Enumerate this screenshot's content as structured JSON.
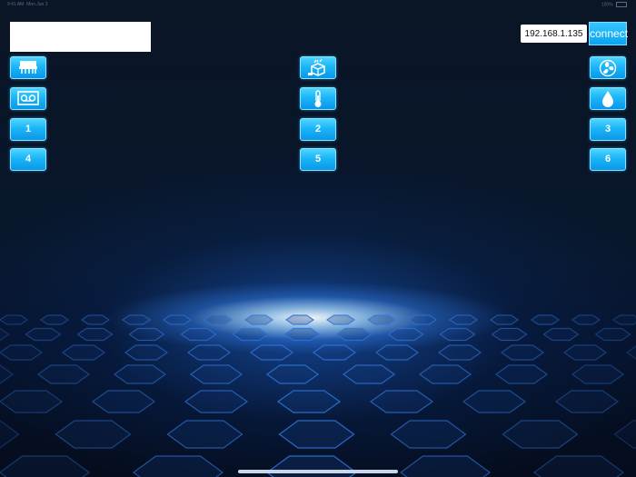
{
  "status_bar": {
    "time": "9:41 AM",
    "date": "Mon Jun 3",
    "battery": "100%"
  },
  "connection": {
    "ip_value": "192.168.1.135",
    "connect_label": "connect"
  },
  "device_name": {
    "value": ""
  },
  "buttons": {
    "b1": "1",
    "b2": "2",
    "b3": "3",
    "b4": "4",
    "b5": "5",
    "b6": "6"
  },
  "icons": {
    "left_row1": "printer-icon",
    "left_row2": "cassette-icon",
    "mid_row1": "package-box-icon",
    "mid_row2": "thermometer-icon",
    "right_row1": "fan-icon",
    "right_row2": "water-drop-icon"
  },
  "colors": {
    "tile": "#1cb5f7",
    "tile_border": "#8ae4ff",
    "background": "#07101f",
    "glow": "#3c8cff"
  }
}
